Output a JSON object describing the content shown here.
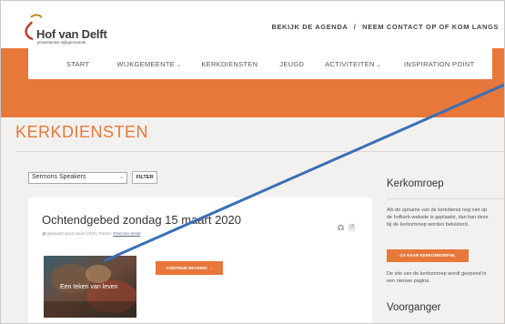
{
  "header": {
    "logo_name": "Hof van Delft",
    "logo_subtitle": "protestantse wijkgemeente",
    "links": [
      "BEKIJK DE AGENDA",
      "NEEM CONTACT OP OF KOM LANGS"
    ],
    "link_separator": "/"
  },
  "nav": {
    "items": [
      {
        "label": "START",
        "dropdown": false
      },
      {
        "label": "WIJKGEMEENTE",
        "dropdown": true
      },
      {
        "label": "KERKDIENSTEN",
        "dropdown": false
      },
      {
        "label": "JEUGD",
        "dropdown": false
      },
      {
        "label": "ACTIVITEITEN",
        "dropdown": true
      },
      {
        "label": "INSPIRATION POINT",
        "dropdown": false
      }
    ]
  },
  "page": {
    "title": "KERKDIENSTEN"
  },
  "filter": {
    "select_value": "Sermons Speakers",
    "button_label": "FILTER"
  },
  "sermon": {
    "title": "Ochtendgebed zondag 15 maart 2020",
    "meta_prefix": "geplaatst op13 maart 2020 | Pastor:",
    "meta_pastor": "Fred van Iersel",
    "image_caption": "Een teken van leven",
    "continue_label": "CONTINUE READING →",
    "icons": [
      "headphones-icon",
      "document-icon"
    ]
  },
  "sidebar": {
    "kerkomroep_title": "Kerkomroep",
    "kerkomroep_text": "Als de opname van de kerkdienst nog niet op de hofkerk-website is geplaatst, dan kan deze bij de kerkomroep worden beluisterd.",
    "kerkomroep_button": "GA NAAR KERKOMROEP.NL",
    "kerkomroep_note": "De site van de kerkomroep wordt geopend in een nieuwe pagina.",
    "voorganger_title": "Voorganger"
  },
  "colors": {
    "accent": "#e8773a",
    "annotation_line": "#3b6fb6"
  }
}
